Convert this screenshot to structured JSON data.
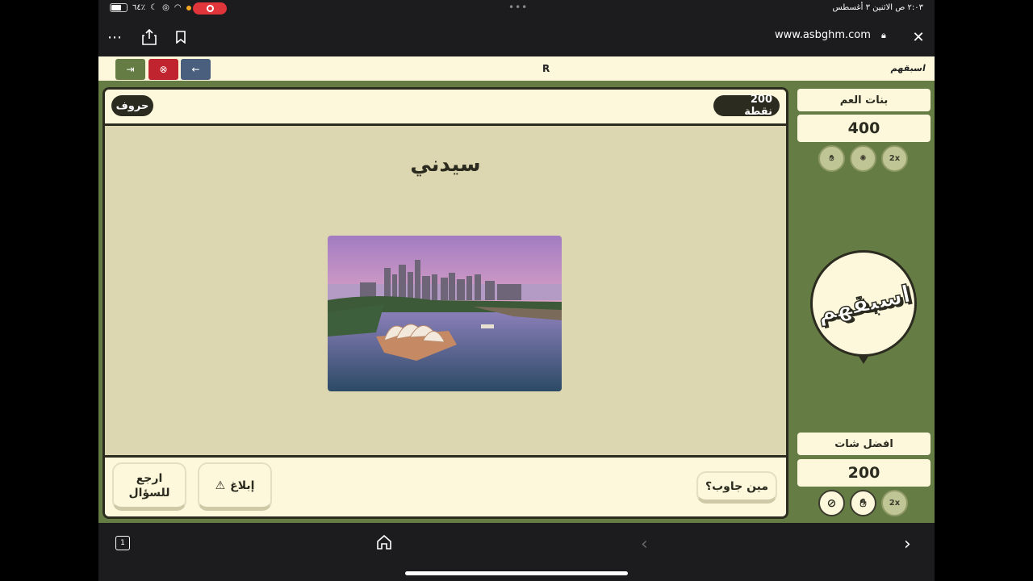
{
  "status_bar": {
    "battery": "٦٤٪",
    "time_date": "٢:٠٣ ص   الاثنين ٣ أغسطس",
    "dots": "•••"
  },
  "browser": {
    "url": "www.asbghm.com",
    "more_icon": "ellipsis-icon",
    "share_icon": "share-icon",
    "bookmark_icon": "bookmark-icon",
    "close_icon": "close-icon",
    "lock_icon": "lock-icon"
  },
  "header": {
    "room_code": "R",
    "small_logo": "اسبقهم"
  },
  "question": {
    "category": "حروف",
    "points": "200 نقطة",
    "answer": "سيدني",
    "image_alt": "Sydney Opera House and skyline"
  },
  "footer": {
    "back_to_question": "ارجع للسؤال",
    "report": "إبلاغ",
    "who_answered": "مين جاوب؟"
  },
  "teams": [
    {
      "name": "بنات العم",
      "score": "400",
      "aids": [
        "hand-icon",
        "spin-icon",
        "2x"
      ]
    },
    {
      "name": "افضل شات",
      "score": "200",
      "aids": [
        "ban-icon",
        "hand-icon",
        "2x"
      ]
    }
  ],
  "logo_text": "اسبقهم",
  "colors": {
    "primary_green": "#667c45",
    "cream": "#fdf8dc",
    "dark": "#2b2b1f",
    "red": "#c0252f",
    "blue": "#4a5e7e"
  }
}
